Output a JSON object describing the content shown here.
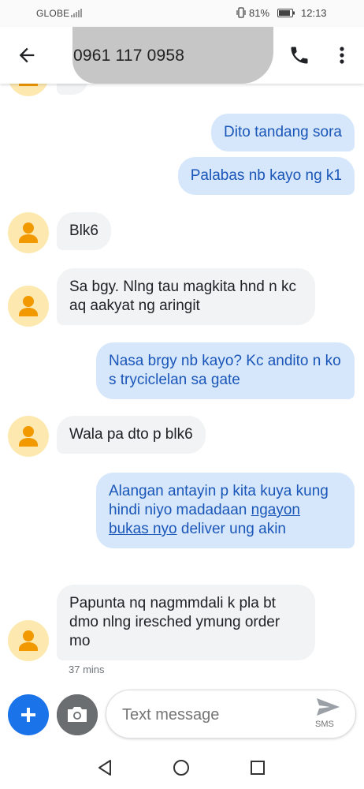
{
  "status_bar": {
    "carrier": "GLOBE",
    "battery": "81%",
    "time": "12:13"
  },
  "header": {
    "contact": "0961 117 0958"
  },
  "messages": [
    {
      "dir": "out",
      "text": "Dito tandang sora"
    },
    {
      "dir": "out",
      "text": "Palabas nb kayo ng k1"
    },
    {
      "dir": "in",
      "text": "Blk6"
    },
    {
      "dir": "in",
      "text": "Sa bgy. Nlng tau magkita hnd n kc aq aakyat ng aringit"
    },
    {
      "dir": "out",
      "text": "Nasa brgy nb kayo? Kc andito n ko s tryciclelan sa gate"
    },
    {
      "dir": "in",
      "text": "Wala pa dto p blk6"
    },
    {
      "dir": "out",
      "text_before": "Alangan antayin p kita kuya kung hindi niyo madadaan",
      "text_link": "ngayon bukas nyo",
      "text_after": "deliver ung akin"
    },
    {
      "dir": "in",
      "text": "Papunta nq nagmmdali k pla bt dmo nlng iresched ymung order mo"
    }
  ],
  "last_timestamp": "37 mins",
  "compose": {
    "placeholder": "Text message",
    "send_label": "SMS"
  },
  "colors": {
    "accent": "#1a73e8",
    "outgoing_bubble": "#d6e7fb",
    "outgoing_text": "#1a56b8",
    "incoming_bubble": "#f1f3f4",
    "avatar_bg": "#fde9b0",
    "avatar_fg": "#f29900"
  },
  "icons": [
    "signal-icon",
    "vibrate-icon",
    "battery-icon",
    "back-arrow-icon",
    "phone-icon",
    "more-vert-icon",
    "person-icon",
    "plus-icon",
    "camera-icon",
    "send-icon",
    "nav-back-icon",
    "nav-home-icon",
    "nav-recents-icon"
  ]
}
